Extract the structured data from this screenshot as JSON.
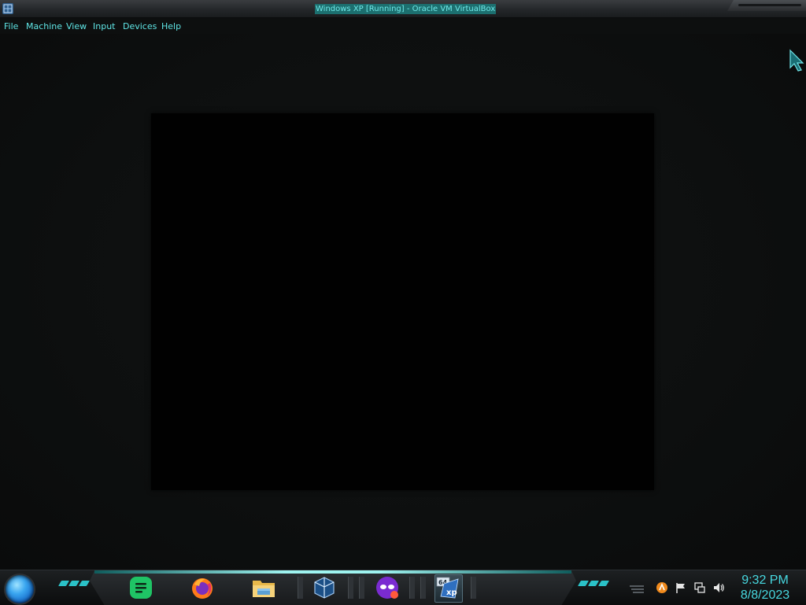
{
  "window": {
    "title": "Windows XP [Running] - Oracle VM VirtualBox",
    "app_icon": "virtualbox-icon"
  },
  "menubar": {
    "items": [
      {
        "label": "File"
      },
      {
        "label": "Machine"
      },
      {
        "label": "View"
      },
      {
        "label": "Input"
      },
      {
        "label": "Devices"
      },
      {
        "label": "Help"
      }
    ]
  },
  "vm": {
    "state": "Running",
    "screen_color": "#010101"
  },
  "taskbar": {
    "start_button": "start-orb-icon",
    "apps": [
      {
        "name": "notes-app",
        "icon": "green-notes-icon"
      },
      {
        "name": "firefox",
        "icon": "firefox-icon"
      },
      {
        "name": "file-explorer",
        "icon": "folder-icon"
      },
      {
        "name": "virtualbox",
        "icon": "virtualbox-cube-icon"
      },
      {
        "name": "masked-app",
        "icon": "purple-mask-icon"
      },
      {
        "name": "windows-xp-vm",
        "icon": "xp64-icon",
        "active": true
      }
    ],
    "tray": {
      "icons": [
        "orange-app-icon",
        "action-center-flag-icon",
        "network-icon",
        "volume-icon"
      ]
    },
    "clock": {
      "time": "9:32 PM",
      "date": "8/8/2023"
    }
  },
  "colors": {
    "accent": "#47d8e0",
    "menu_text": "#5fe6e6",
    "background": "#0c0e0e"
  }
}
